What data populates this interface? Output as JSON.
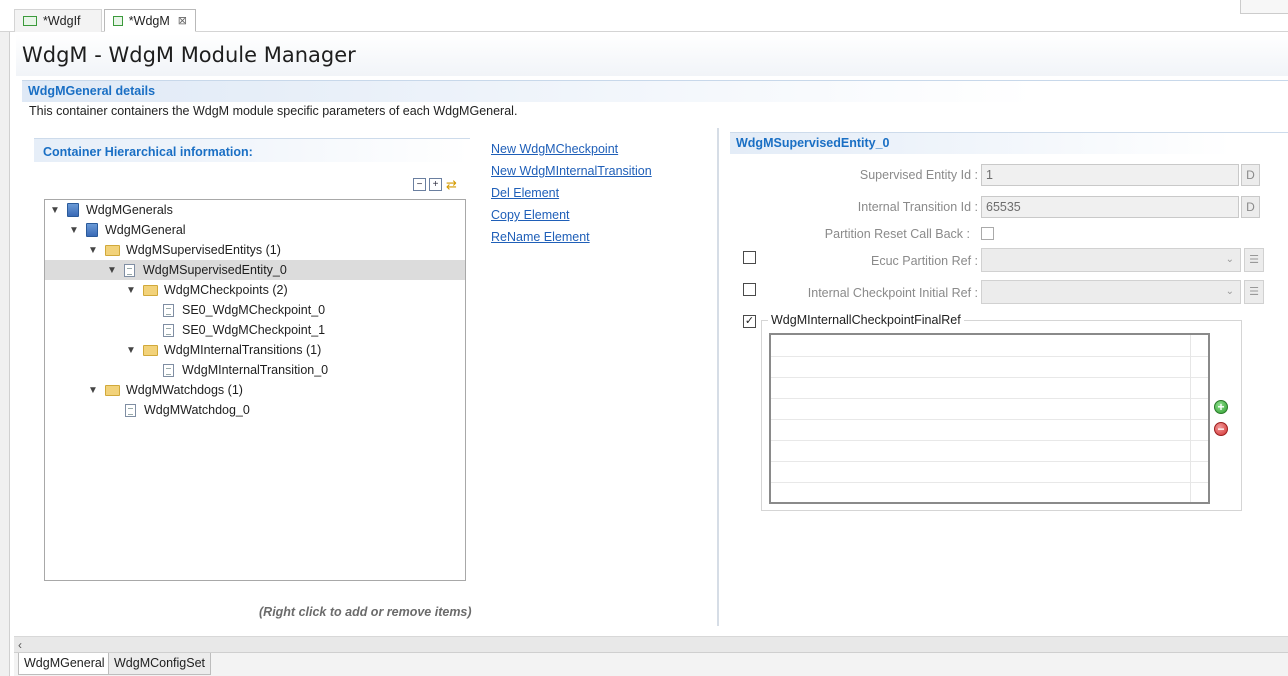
{
  "tabs": [
    {
      "label": "*WdgIf"
    },
    {
      "label": "*WdgM",
      "close": "⊠"
    }
  ],
  "form": {
    "title": "WdgM - WdgM Module Manager"
  },
  "section": {
    "title": "WdgMGeneral details",
    "description": "This container containers the WdgM module specific parameters of each WdgMGeneral."
  },
  "left_panel": {
    "title": "Container Hierarchical information:",
    "hint": "(Right click to add or remove items)",
    "tree": [
      {
        "label": "WdgMGenerals"
      },
      {
        "label": "WdgMGeneral"
      },
      {
        "label": "WdgMSupervisedEntitys (1)"
      },
      {
        "label": "WdgMSupervisedEntity_0"
      },
      {
        "label": "WdgMCheckpoints (2)"
      },
      {
        "label": "SE0_WdgMCheckpoint_0"
      },
      {
        "label": "SE0_WdgMCheckpoint_1"
      },
      {
        "label": "WdgMInternalTransitions (1)"
      },
      {
        "label": "WdgMInternalTransition_0"
      },
      {
        "label": "WdgMWatchdogs (1)"
      },
      {
        "label": "WdgMWatchdog_0"
      }
    ]
  },
  "actions": [
    {
      "label": "New WdgMCheckpoint"
    },
    {
      "label": "New WdgMInternalTransition"
    },
    {
      "label": "Del Element"
    },
    {
      "label": "Copy Element"
    },
    {
      "label": "ReName Element"
    }
  ],
  "detail": {
    "title": "WdgMSupervisedEntity_0",
    "supervised_entity_id": {
      "label": "Supervised Entity Id :",
      "value": "1",
      "button": "D"
    },
    "internal_transition_id": {
      "label": "Internal Transition Id :",
      "value": "65535",
      "button": "D"
    },
    "partition_reset_call_back": {
      "label": "Partition Reset Call Back :"
    },
    "ecuc_partition_ref": {
      "label": "Ecuc Partition Ref :"
    },
    "internal_checkpoint_initial_ref": {
      "label": "Internal Checkpoint Initial Ref :"
    },
    "final_ref_group": {
      "label": "WdgMInternallCheckpointFinalRef"
    }
  },
  "page_tabs": [
    {
      "label": "WdgMGeneral"
    },
    {
      "label": "WdgMConfigSet"
    }
  ]
}
